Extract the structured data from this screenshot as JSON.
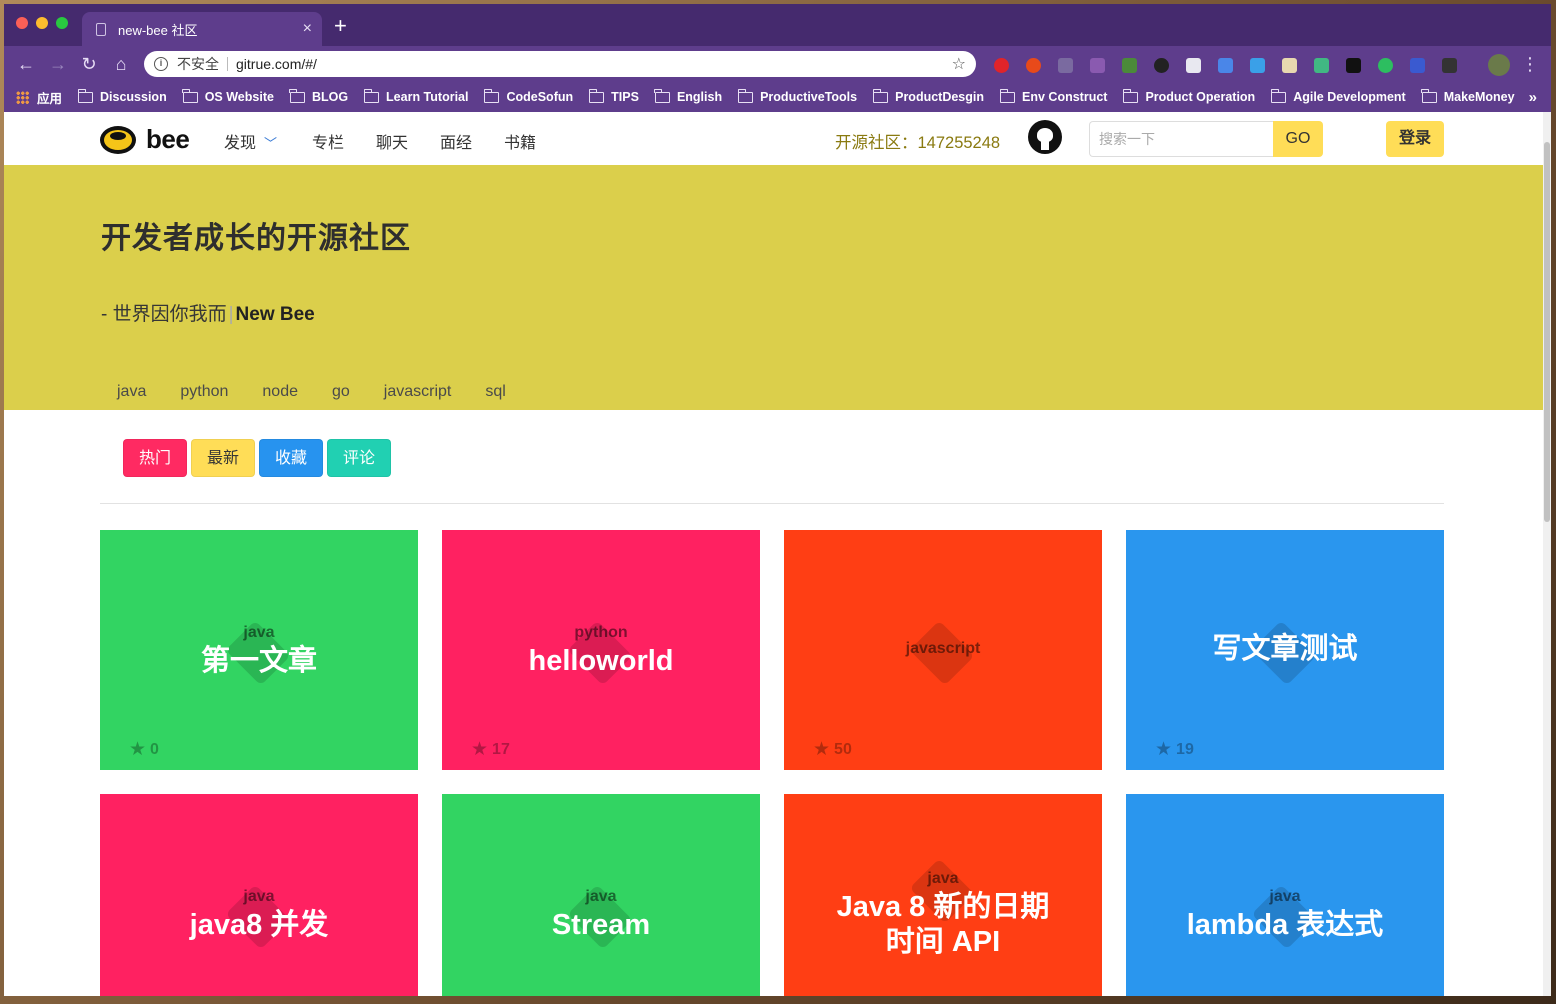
{
  "browser": {
    "tab_title": "new-bee 社区",
    "tab_close": "×",
    "new_tab": "+",
    "url_security": "不安全",
    "url": "gitrue.com/#/",
    "bookmarks": [
      {
        "label": "应用",
        "icon": "apps-grid-icon"
      },
      {
        "label": "Discussion",
        "icon": "folder-icon"
      },
      {
        "label": "OS Website",
        "icon": "folder-icon"
      },
      {
        "label": "BLOG",
        "icon": "folder-icon"
      },
      {
        "label": "Learn Tutorial",
        "icon": "folder-icon"
      },
      {
        "label": "CodeSofun",
        "icon": "folder-icon"
      },
      {
        "label": "TIPS",
        "icon": "folder-icon"
      },
      {
        "label": "English",
        "icon": "folder-icon"
      },
      {
        "label": "ProductiveTools",
        "icon": "folder-icon"
      },
      {
        "label": "ProductDesgin",
        "icon": "folder-icon"
      },
      {
        "label": "Env Construct",
        "icon": "folder-icon"
      },
      {
        "label": "Product Operation",
        "icon": "folder-icon"
      },
      {
        "label": "Agile Development",
        "icon": "folder-icon"
      },
      {
        "label": "MakeMoney",
        "icon": "folder-icon"
      }
    ],
    "bookmarks_more": "»"
  },
  "nav": {
    "logo_text": "bee",
    "links": [
      "发现",
      "专栏",
      "聊天",
      "面经",
      "书籍"
    ],
    "community": "开源社区：147255248",
    "search_placeholder": "搜索一下",
    "search_button": "GO",
    "login": "登录"
  },
  "hero": {
    "title": "开发者成长的开源社区",
    "subtitle_prefix": "- 世界因你我而",
    "subtitle_sep": "|",
    "subtitle_brand": "New Bee",
    "tags": [
      "java",
      "python",
      "node",
      "go",
      "javascript",
      "sql"
    ]
  },
  "filters": [
    {
      "label": "热门",
      "bg": "#ff2a62",
      "fg": "#ffffff"
    },
    {
      "label": "最新",
      "bg": "#ffdd57",
      "fg": "#363636"
    },
    {
      "label": "收藏",
      "bg": "#2793ef",
      "fg": "#ffffff"
    },
    {
      "label": "评论",
      "bg": "#21d0b2",
      "fg": "#ffffff"
    }
  ],
  "cards": [
    {
      "tag": "java",
      "title": "第一文章",
      "stars": "0",
      "color": "#32d462"
    },
    {
      "tag": "python",
      "title": "helloworld",
      "stars": "17",
      "color": "#ff2161"
    },
    {
      "tag": "javascript",
      "title": "",
      "stars": "50",
      "color": "#ff3e14"
    },
    {
      "tag": "",
      "title": "写文章测试",
      "stars": "19",
      "color": "#2a96ee"
    },
    {
      "tag": "java",
      "title": "java8 并发",
      "stars": "",
      "color": "#ff2161"
    },
    {
      "tag": "java",
      "title": "Stream",
      "stars": "",
      "color": "#32d462"
    },
    {
      "tag": "java",
      "title": "Java 8 新的日期\n时间 API",
      "stars": "",
      "color": "#ff3e14"
    },
    {
      "tag": "java",
      "title": "lambda 表达式",
      "stars": "",
      "color": "#2a96ee"
    }
  ]
}
